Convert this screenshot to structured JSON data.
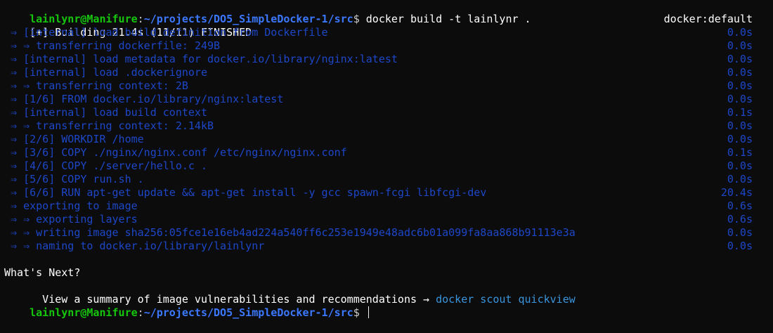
{
  "prompt": {
    "user_host": "lainlynr@Manifure",
    "separator": ":",
    "path": "~/projects/DO5_SimpleDocker-1/src",
    "symbol": "$ "
  },
  "command": "docker build -t lainlynr .",
  "build_header": {
    "status": "[+] Building 21.4s (11/11) FINISHED",
    "context": "docker:default"
  },
  "steps": [
    {
      "text": " ⇒ [internal] load build definition from Dockerfile",
      "time": "0.0s"
    },
    {
      "text": " ⇒ ⇒ transferring dockerfile: 249B",
      "time": "0.0s"
    },
    {
      "text": " ⇒ [internal] load metadata for docker.io/library/nginx:latest",
      "time": "0.0s"
    },
    {
      "text": " ⇒ [internal] load .dockerignore",
      "time": "0.0s"
    },
    {
      "text": " ⇒ ⇒ transferring context: 2B",
      "time": "0.0s"
    },
    {
      "text": " ⇒ [1/6] FROM docker.io/library/nginx:latest",
      "time": "0.0s"
    },
    {
      "text": " ⇒ [internal] load build context",
      "time": "0.1s"
    },
    {
      "text": " ⇒ ⇒ transferring context: 2.14kB",
      "time": "0.0s"
    },
    {
      "text": " ⇒ [2/6] WORKDIR /home",
      "time": "0.0s"
    },
    {
      "text": " ⇒ [3/6] COPY ./nginx/nginx.conf /etc/nginx/nginx.conf",
      "time": "0.1s"
    },
    {
      "text": " ⇒ [4/6] COPY ./server/hello.c .",
      "time": "0.0s"
    },
    {
      "text": " ⇒ [5/6] COPY run.sh .",
      "time": "0.0s"
    },
    {
      "text": " ⇒ [6/6] RUN apt-get update && apt-get install -y gcc spawn-fcgi libfcgi-dev",
      "time": "20.4s"
    },
    {
      "text": " ⇒ exporting to image",
      "time": "0.6s"
    },
    {
      "text": " ⇒ ⇒ exporting layers",
      "time": "0.6s"
    },
    {
      "text": " ⇒ ⇒ writing image sha256:05fce1e16eb4ad224a540ff6c253e1949e48adc6b01a099fa8aa868b91113e3a",
      "time": "0.0s"
    },
    {
      "text": " ⇒ ⇒ naming to docker.io/library/lainlynr",
      "time": "0.0s"
    }
  ],
  "whats_next": {
    "title": "What's Next?",
    "summary": "  View a summary of image vulnerabilities and recommendations → ",
    "command": "docker scout quickview"
  },
  "colors": {
    "background": "#0c0c0c",
    "user_host": "#16c60c",
    "path": "#3b78ff",
    "step_text": "#1d47c8",
    "link": "#3a96dd"
  }
}
